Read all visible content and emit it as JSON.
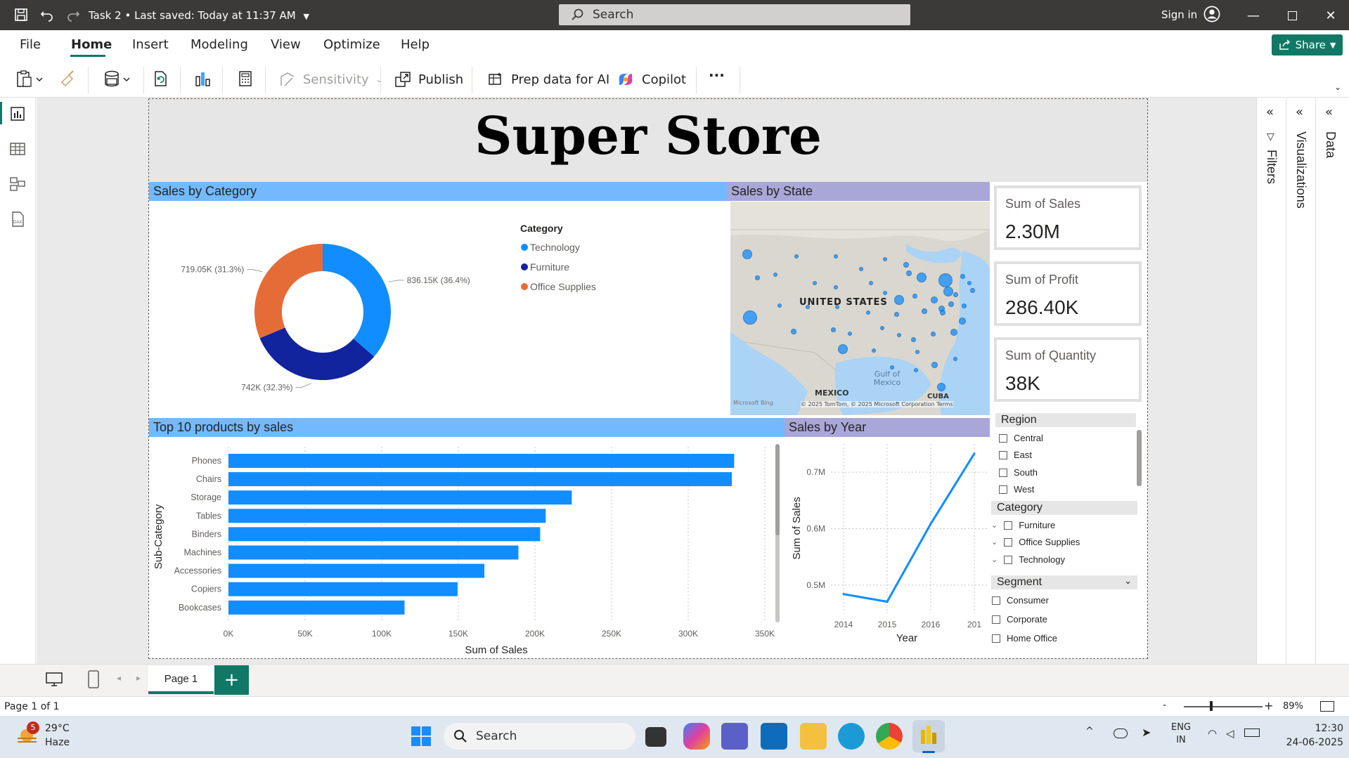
{
  "titlebar": {
    "doc_title": "Task 2 • Last saved: Today at 11:37 AM",
    "search_placeholder": "Search",
    "sign_in": "Sign in"
  },
  "menu": {
    "items": [
      "File",
      "Home",
      "Insert",
      "Modeling",
      "View",
      "Optimize",
      "Help"
    ],
    "active": "Home",
    "share": "Share"
  },
  "ribbon": {
    "sensitivity": "Sensitivity",
    "publish": "Publish",
    "prep_data": "Prep data for AI",
    "copilot": "Copilot",
    "more": "···"
  },
  "report": {
    "title": "Super Store",
    "sales_by_category_title": "Sales by Category",
    "sales_by_state_title": "Sales by State",
    "top10_title": "Top 10 products by sales",
    "sales_by_year_title": "Sales by Year",
    "map": {
      "label_us": "UNITED STATES",
      "label_gulf": "Gulf of Mexico",
      "label_mexico": "MEXICO",
      "label_cuba": "CUBA",
      "credits": "© 2025 TomTom, © 2025 Microsoft Corporation Terms",
      "brand": "Microsoft Bing"
    }
  },
  "kpis": [
    {
      "label": "Sum of Sales",
      "value": "2.30M"
    },
    {
      "label": "Sum of Profit",
      "value": "286.40K"
    },
    {
      "label": "Sum of Quantity",
      "value": "38K"
    }
  ],
  "slicers": {
    "region": {
      "title": "Region",
      "items": [
        "Central",
        "East",
        "South",
        "West"
      ]
    },
    "category": {
      "title": "Category",
      "items": [
        "Furniture",
        "Office Supplies",
        "Technology"
      ]
    },
    "segment": {
      "title": "Segment",
      "items": [
        "Consumer",
        "Corporate",
        "Home Office"
      ]
    }
  },
  "panes": {
    "filters": "Filters",
    "visualizations": "Visualizations",
    "data": "Data"
  },
  "pages": {
    "tab": "Page 1",
    "add": "+"
  },
  "status": {
    "page_info": "Page 1 of 1",
    "zoom": "89%"
  },
  "taskbar": {
    "weather_temp": "29°C",
    "weather_desc": "Haze",
    "weather_badge": "5",
    "search": "Search",
    "lang1": "ENG",
    "lang2": "IN",
    "time": "12:30",
    "date": "24-06-2025"
  },
  "chart_data": [
    {
      "type": "pie",
      "title": "Sales by Category",
      "legend_title": "Category",
      "categories": [
        "Technology",
        "Furniture",
        "Office Supplies"
      ],
      "values": [
        836150,
        742000,
        719050
      ],
      "data_labels": [
        "836.15K (36.4%)",
        "742K (32.3%)",
        "719.05K (31.3%)"
      ],
      "colors": [
        "#118dff",
        "#12239e",
        "#e66c37"
      ],
      "donut": true,
      "legend_position": "right"
    },
    {
      "type": "bar",
      "orientation": "horizontal",
      "title": "Top 10 products by sales",
      "categories": [
        "Phones",
        "Chairs",
        "Storage",
        "Tables",
        "Binders",
        "Machines",
        "Accessories",
        "Copiers",
        "Bookcases"
      ],
      "values": [
        330000,
        328500,
        224000,
        207000,
        203400,
        189200,
        167000,
        149500,
        114900
      ],
      "xlabel": "Sum of Sales",
      "ylabel": "Sub-Category",
      "xlim": [
        0,
        350000
      ],
      "xticks": [
        "0K",
        "50K",
        "100K",
        "150K",
        "200K",
        "250K",
        "300K",
        "350K"
      ],
      "color": "#118dff",
      "grid": true
    },
    {
      "type": "line",
      "title": "Sales by Year",
      "x": [
        "2014",
        "2015",
        "2016",
        "201"
      ],
      "values": [
        484000,
        470500,
        608500,
        733000
      ],
      "xlabel": "Year",
      "ylabel": "Sum of Sales",
      "ylim": [
        0.45,
        0.75
      ],
      "yticks": [
        "0.5M",
        "0.6M",
        "0.7M"
      ],
      "color": "#118dff",
      "grid": true
    }
  ]
}
